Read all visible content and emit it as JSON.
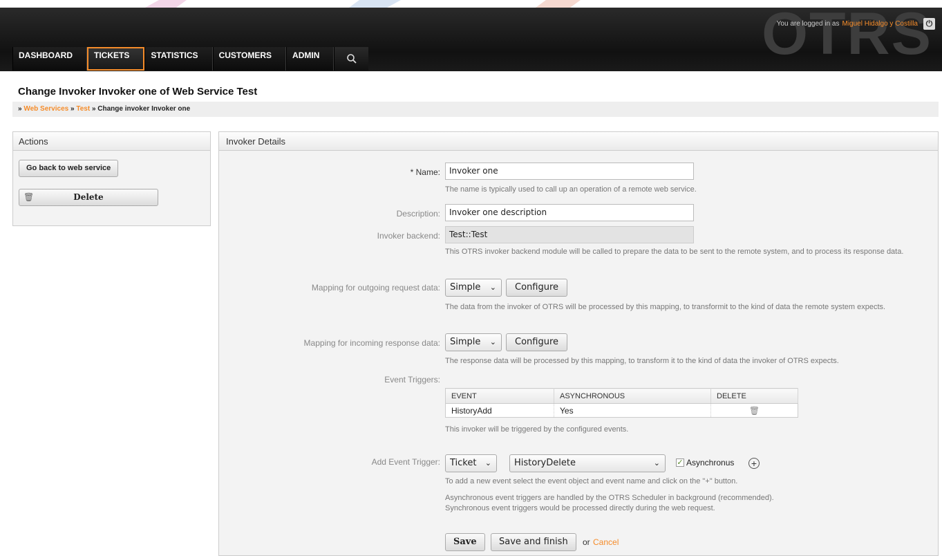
{
  "colors": {
    "accent": "#f58c2a",
    "header_bg": "#111111",
    "panel_bg": "#f3f3f3"
  },
  "header": {
    "logo": "OTRS",
    "login_prefix": "You are logged in as",
    "user": "Miguel Hidalgo y Costilla",
    "logout_icon": "power-icon"
  },
  "nav": {
    "items": [
      "DASHBOARD",
      "TICKETS",
      "STATISTICS",
      "CUSTOMERS",
      "ADMIN"
    ],
    "active": "TICKETS",
    "search_icon": "search-icon"
  },
  "page": {
    "title": "Change Invoker Invoker one of Web Service Test",
    "breadcrumb": {
      "sep": "»",
      "crumb1": "Web Services",
      "crumb2": "Test",
      "current": "Change invoker Invoker one"
    }
  },
  "actions": {
    "title": "Actions",
    "back_label": "Go back to web service",
    "delete_label": "Delete"
  },
  "details": {
    "title": "Invoker Details",
    "name_label": "* Name:",
    "name_value": "Invoker one",
    "name_hint": "The name is typically used to call up an operation of a remote web service.",
    "description_label": "Description:",
    "description_value": "Invoker one description",
    "backend_label": "Invoker backend:",
    "backend_value": "Test::Test",
    "backend_hint": "This OTRS invoker backend module will be called to prepare the data to be sent to the remote system, and to process its response data.",
    "outgoing_label": "Mapping for outgoing request data:",
    "outgoing_value": "Simple",
    "outgoing_configure": "Configure",
    "outgoing_hint": "The data from the invoker of OTRS will be processed by this mapping, to transformit to the kind of data the remote system expects.",
    "incoming_label": "Mapping for incoming response data:",
    "incoming_value": "Simple",
    "incoming_configure": "Configure",
    "incoming_hint": "The response data will be processed by this mapping, to transform it to the kind of data the invoker of OTRS expects.",
    "triggers_label": "Event Triggers:",
    "table": {
      "headers": [
        "EVENT",
        "ASYNCHRONOUS",
        "DELETE"
      ],
      "rows": [
        {
          "event": "HistoryAdd",
          "async": "Yes",
          "delete_icon": "trash-icon"
        }
      ]
    },
    "triggers_hint": "This invoker will be triggered by the configured events.",
    "add_label": "Add Event Trigger:",
    "add_object": "Ticket",
    "add_event": "HistoryDelete",
    "async_label": "Asynchronus",
    "async_checked": true,
    "add_hint": "To add a new event select the event object and event name and click on the \"+\" button.",
    "async_hint_1": "Asynchronous event triggers are handled by the OTRS Scheduler in background (recommended).",
    "async_hint_2": "Synchronous event triggers would be processed directly during the web request.",
    "save_label": "Save",
    "save_finish_label": "Save and finish",
    "or_label": "or",
    "cancel_label": "Cancel"
  }
}
